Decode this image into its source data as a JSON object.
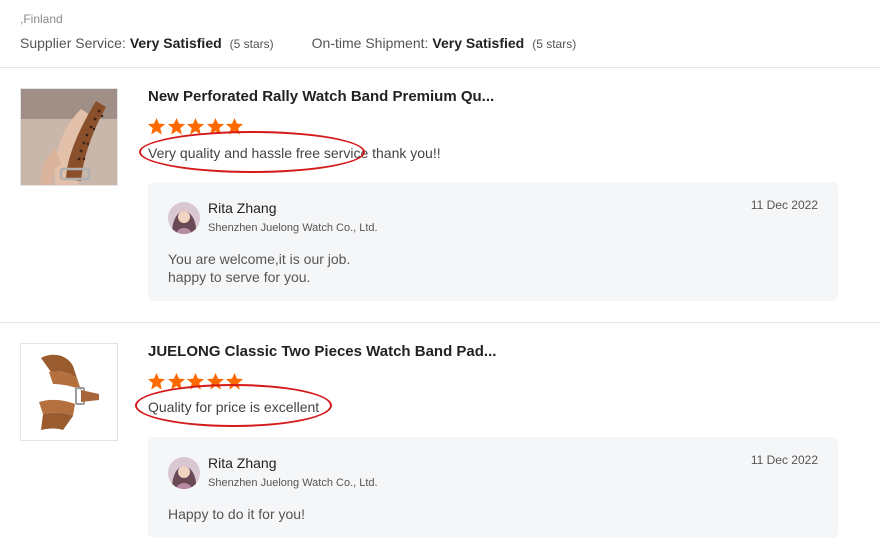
{
  "header": {
    "location": ",Finland",
    "ratings": [
      {
        "label": "Supplier Service:",
        "value": "Very Satisfied",
        "stars": "(5 stars)"
      },
      {
        "label": "On-time Shipment:",
        "value": "Very Satisfied",
        "stars": "(5 stars)"
      }
    ]
  },
  "colors": {
    "star": "#ff6a00",
    "annotation": "#d41a1a",
    "reply_bg": "#f5f6f8"
  },
  "reviews": [
    {
      "product_title": "New Perforated Rally Watch Band Premium Qu...",
      "rating": 5,
      "comment": "Very quality and hassle free service thank you!!",
      "thumbnail_icon": "perforated-watch-band-photo",
      "reply": {
        "name": "Rita Zhang",
        "company": "Shenzhen Juelong Watch Co., Ltd.",
        "date": "11 Dec 2022",
        "lines": [
          "You are welcome,it is our job.",
          "happy to serve for you."
        ]
      }
    },
    {
      "product_title": "JUELONG Classic Two Pieces Watch Band Pad...",
      "rating": 5,
      "comment": "Quality for price is excellent",
      "thumbnail_icon": "leather-watch-band-photo",
      "reply": {
        "name": "Rita Zhang",
        "company": "Shenzhen Juelong Watch Co., Ltd.",
        "date": "11 Dec 2022",
        "lines": [
          "Happy to do it for you!"
        ]
      }
    }
  ]
}
